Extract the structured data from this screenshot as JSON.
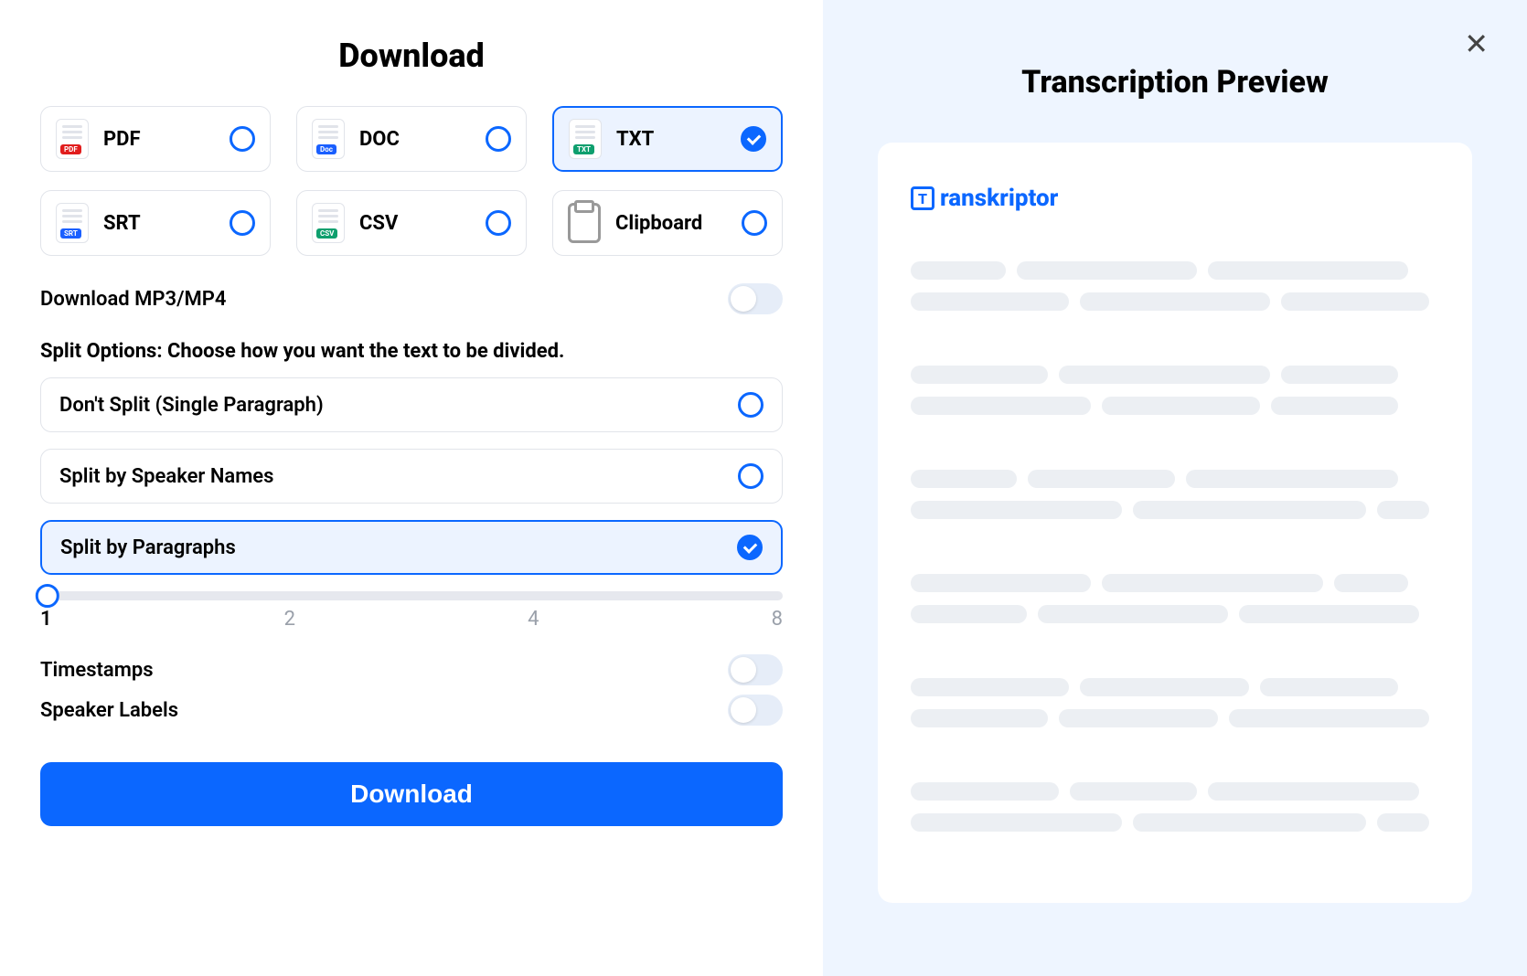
{
  "left": {
    "title": "Download",
    "formats": [
      {
        "id": "pdf",
        "label": "PDF",
        "tagClass": "tag-pdf",
        "tagText": "PDF",
        "selected": false,
        "iconType": "doc"
      },
      {
        "id": "doc",
        "label": "DOC",
        "tagClass": "tag-doc",
        "tagText": "Doc",
        "selected": false,
        "iconType": "doc"
      },
      {
        "id": "txt",
        "label": "TXT",
        "tagClass": "tag-txt",
        "tagText": "TXT",
        "selected": true,
        "iconType": "doc"
      },
      {
        "id": "srt",
        "label": "SRT",
        "tagClass": "tag-srt",
        "tagText": "SRT",
        "selected": false,
        "iconType": "doc"
      },
      {
        "id": "csv",
        "label": "CSV",
        "tagClass": "tag-csv",
        "tagText": "CSV",
        "selected": false,
        "iconType": "doc"
      },
      {
        "id": "clipboard",
        "label": "Clipboard",
        "tagClass": "",
        "tagText": "",
        "selected": false,
        "iconType": "clipboard"
      }
    ],
    "download_media_label": "Download MP3/MP4",
    "download_media_on": false,
    "split_heading": "Split Options: Choose how you want the text to be divided.",
    "split_options": [
      {
        "id": "nosplit",
        "label": "Don't Split (Single Paragraph)",
        "selected": false
      },
      {
        "id": "speaker",
        "label": "Split by Speaker Names",
        "selected": false
      },
      {
        "id": "paragraphs",
        "label": "Split by Paragraphs",
        "selected": true
      }
    ],
    "slider": {
      "value": 1,
      "ticks": [
        "1",
        "2",
        "4",
        "8"
      ]
    },
    "timestamps_label": "Timestamps",
    "timestamps_on": false,
    "speaker_labels_label": "Speaker Labels",
    "speaker_labels_on": false,
    "download_button": "Download"
  },
  "right": {
    "title": "Transcription Preview",
    "brand_glyph": "T",
    "brand_text": "ranskriptor"
  }
}
